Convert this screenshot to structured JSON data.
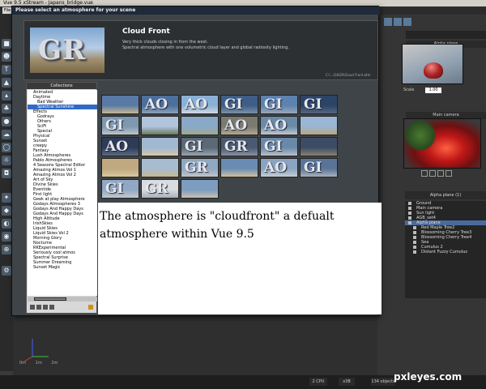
{
  "window": {
    "title": "Vue 9.5 xStream - Japans_bridge.vue"
  },
  "menubar": {
    "file_label": "File"
  },
  "dialog": {
    "title": "Please select an atmosphere for your scene",
    "preset": {
      "name": "Cloud Front",
      "desc_line1": "Very thick clouds closing in from the west.",
      "desc_line2": "Spectral atmosphere with one volumetric cloud layer and global radiosity lighting.",
      "path": "C:\\...\\GI\\GR\\Cloud Front.atm",
      "thumb_text": "GR"
    },
    "collections_title": "Collections",
    "collections": [
      {
        "label": "Animated",
        "level": 0
      },
      {
        "label": "Daytime",
        "level": 0
      },
      {
        "label": "Bad Weather",
        "level": 1
      },
      {
        "label": "Spectral Sunshine",
        "level": 1,
        "selected": true
      },
      {
        "label": "Effects",
        "level": 0
      },
      {
        "label": "Godrays",
        "level": 1
      },
      {
        "label": "Others",
        "level": 1
      },
      {
        "label": "SciFi",
        "level": 1
      },
      {
        "label": "Special",
        "level": 1
      },
      {
        "label": "Physical",
        "level": 0
      },
      {
        "label": "Sunset",
        "level": 0
      },
      {
        "label": "creepy",
        "level": 0
      },
      {
        "label": "Fantasy",
        "level": 0
      },
      {
        "label": "Lush Atmospheres",
        "level": 0
      },
      {
        "label": "Pablo Atmospheres",
        "level": 0
      },
      {
        "label": "4 Seasons Spectral Editor",
        "level": 0
      },
      {
        "label": "Amazing Atmos Vol 1",
        "level": 0
      },
      {
        "label": "Amazing Atmos Vol 2",
        "level": 0
      },
      {
        "label": "Art of Sky",
        "level": 0
      },
      {
        "label": "Divine Skies",
        "level": 0
      },
      {
        "label": "Eventide",
        "level": 0
      },
      {
        "label": "First light",
        "level": 0
      },
      {
        "label": "Geek at play Atmosphere",
        "level": 0
      },
      {
        "label": "Godays Atmospheres 3",
        "level": 0
      },
      {
        "label": "Godays And Happy Days",
        "level": 0
      },
      {
        "label": "Godays And Happy Days",
        "level": 0
      },
      {
        "label": "High Altitude",
        "level": 0
      },
      {
        "label": "IrishSkies",
        "level": 0
      },
      {
        "label": "Liquid Skies",
        "level": 0
      },
      {
        "label": "Liquid Skies Vol 2",
        "level": 0
      },
      {
        "label": "Morning Glory",
        "level": 0
      },
      {
        "label": "Nocturne",
        "level": 0
      },
      {
        "label": "RKExperimental",
        "level": 0
      },
      {
        "label": "Seriously cool atmos",
        "level": 0
      },
      {
        "label": "Spectral Surprise",
        "level": 0
      },
      {
        "label": "Summer Dreaming",
        "level": 0
      },
      {
        "label": "Sunset Magic",
        "level": 0
      }
    ],
    "thumbnails": [
      {
        "text": "",
        "sky": "#5a7aa6",
        "ground": "#c8b890"
      },
      {
        "text": "AO",
        "sky": "#4d6f9c",
        "ground": "#8aa0b8"
      },
      {
        "text": "AO",
        "sky": "#8ab0d6",
        "ground": "#d0d8e0"
      },
      {
        "text": "GI",
        "sky": "#3e5e88",
        "ground": "#7a90a8"
      },
      {
        "text": "GI",
        "sky": "#5c82b0",
        "ground": "#9aa8b8"
      },
      {
        "text": "GI",
        "sky": "#2c4468",
        "ground": "#566880"
      },
      {
        "text": "GI",
        "sky": "#7e98b0",
        "ground": "#bcc4cc"
      },
      {
        "text": "",
        "sky": "#b0c4dc",
        "ground": "#6a7a60"
      },
      {
        "text": "",
        "sky": "#8aa8c8",
        "ground": "#a0a890"
      },
      {
        "text": "AO",
        "sky": "#7a7a70",
        "ground": "#b0a890"
      },
      {
        "text": "AO",
        "sky": "#6a8aa8",
        "ground": "#c0c8d0"
      },
      {
        "text": "",
        "sky": "#9ab6d4",
        "ground": "#b8a880"
      },
      {
        "text": "AO",
        "sky": "#2e3c58",
        "ground": "#5a6a82"
      },
      {
        "text": "",
        "sky": "#a0b8d2",
        "ground": "#d4c8a8"
      },
      {
        "text": "GI",
        "sky": "#5a6878",
        "ground": "#98a4b0"
      },
      {
        "text": "GR",
        "sky": "#4a5a70",
        "ground": "#8890a0"
      },
      {
        "text": "GI",
        "sky": "#6a88a8",
        "ground": "#b8c0c8"
      },
      {
        "text": "",
        "sky": "#3c4c64",
        "ground": "#8a8070"
      },
      {
        "text": "",
        "sky": "#c0a880",
        "ground": "#d8c8a0"
      },
      {
        "text": "",
        "sky": "#a8bcd0",
        "ground": "#c8b890"
      },
      {
        "text": "GR",
        "sky": "#90a8c0",
        "ground": "#c0c4c8"
      },
      {
        "text": "",
        "sky": "#6a8cb4",
        "ground": "#d0c0a0"
      },
      {
        "text": "AO",
        "sky": "#8aa4c0",
        "ground": "#c8ccd0"
      },
      {
        "text": "GI",
        "sky": "#5a7498",
        "ground": "#a8b0b8"
      },
      {
        "text": "GI",
        "sky": "#90a8c4",
        "ground": "#c4c8cc"
      },
      {
        "text": "GR",
        "sky": "#d8dce0",
        "ground": "#a8b0b8"
      },
      {
        "text": "",
        "sky": "#7c9cc0",
        "ground": "#c8c0b0"
      }
    ],
    "annotation": "The atmosphere is \"cloudfront\" a defualt atmosphere within Vue 9.5"
  },
  "right_panel": {
    "alpha_plane_caption": "Alpha plane",
    "scale_label": "Scale",
    "scale_value": "1.00",
    "main_camera_caption": "Main camera",
    "scene_header": "Alpha plane (1)",
    "scene_items": [
      {
        "label": "Ground",
        "level": 0
      },
      {
        "label": "Main camera",
        "level": 0
      },
      {
        "label": "Sun light",
        "level": 0
      },
      {
        "label": "AGB_set4",
        "level": 0
      },
      {
        "label": "Alpha plane",
        "level": 0,
        "selected": true
      },
      {
        "label": "Red Maple Tree2",
        "level": 1
      },
      {
        "label": "Blossoming Cherry Tree3",
        "level": 1
      },
      {
        "label": "Blossoming Cherry Tree4",
        "level": 1
      },
      {
        "label": "Sea",
        "level": 1
      },
      {
        "label": "Cumulus 2",
        "level": 1
      },
      {
        "label": "Distant Fuzzy Cumulus",
        "level": 1
      }
    ]
  },
  "viewport": {
    "scale_marks": [
      "0m",
      "1m",
      "2m"
    ]
  },
  "status": {
    "cpu": "2 CPU",
    "memory": "x3B",
    "objects": "134 objects"
  },
  "watermark": "pxleyes.com"
}
